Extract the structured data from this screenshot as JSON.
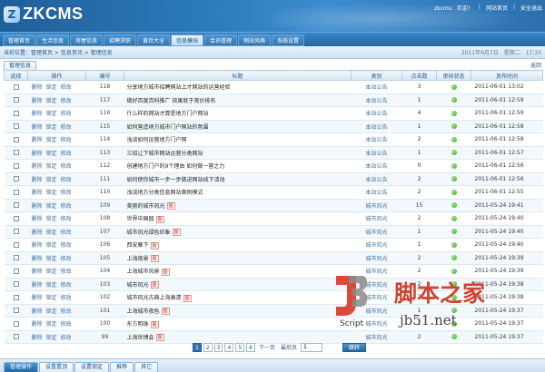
{
  "header": {
    "logo_text": "ZKCMS",
    "logo_mark": "Z",
    "user": "zkcms：欢迎！",
    "link_home": "网站首页",
    "link_logout": "安全退出"
  },
  "nav": [
    "管理首页",
    "生活信息",
    "房屋信息",
    "招聘求职",
    "黄页大全",
    "信息模块",
    "会员管理",
    "网站风格",
    "系统设置"
  ],
  "nav_active_index": 5,
  "crumb": "当前位置：管理首页 > 信息资讯 > 管理信息",
  "date": "2011年6月7日　星期二　17:33",
  "tab": "管理信息",
  "back_label": "返回",
  "columns": [
    "选择",
    "操作",
    "编号",
    "标题",
    "类别",
    "点击数",
    "审核状态",
    "发布时间"
  ],
  "ops": [
    "删除",
    "锁定",
    "修改"
  ],
  "rows": [
    {
      "id": "118",
      "title": "分享地方城市招聘网站上才网站的运营经验",
      "tag": "",
      "cat": "本站公告",
      "clicks": "3",
      "date": "2011-06-01 13:02"
    },
    {
      "id": "117",
      "title": "做好百度百科推广 效果就于竞价排名",
      "tag": "",
      "cat": "本站公告",
      "clicks": "1",
      "date": "2011-06-01 12:59"
    },
    {
      "id": "116",
      "title": "什么样的网站才算是地方门户网站",
      "tag": "",
      "cat": "本站公告",
      "clicks": "4",
      "date": "2011-06-01 12:59"
    },
    {
      "id": "115",
      "title": "如何营造地方城市门户网站的氛围",
      "tag": "",
      "cat": "本站公告",
      "clicks": "1",
      "date": "2011-06-01 12:58"
    },
    {
      "id": "114",
      "title": "浅谈如何运营地方门户网",
      "tag": "",
      "cat": "本站公告",
      "clicks": "2",
      "date": "2011-06-01 12:58"
    },
    {
      "id": "113",
      "title": "三招让下城市网站运营分类网站",
      "tag": "",
      "cat": "本站公告",
      "clicks": "1",
      "date": "2011-06-01 12:57"
    },
    {
      "id": "112",
      "title": "创建地方门户的9个理由 如何做一营之力",
      "tag": "",
      "cat": "本站公告",
      "clicks": "0",
      "date": "2011-06-01 12:56"
    },
    {
      "id": "111",
      "title": "如何使你城市一步一步做进网站线下活动",
      "tag": "",
      "cat": "本站公告",
      "clicks": "2",
      "date": "2011-06-01 12:56"
    },
    {
      "id": "110",
      "title": "浅谈地方分类信息网站案例模式",
      "tag": "",
      "cat": "本站公告",
      "clicks": "2",
      "date": "2011-06-01 12:55"
    },
    {
      "id": "109",
      "title": "美丽的城市风光",
      "tag": "图",
      "cat": "城市风光",
      "clicks": "15",
      "date": "2011-05-24 19:41"
    },
    {
      "id": "108",
      "title": "世界中国园",
      "tag": "图",
      "cat": "城市风光",
      "clicks": "2",
      "date": "2011-05-24 19:40"
    },
    {
      "id": "107",
      "title": "城市风光绿色印象",
      "tag": "图",
      "cat": "城市风光",
      "clicks": "1",
      "date": "2011-05-24 19:40"
    },
    {
      "id": "106",
      "title": "西安雁下",
      "tag": "图",
      "cat": "城市风光",
      "clicks": "1",
      "date": "2011-05-24 19:40"
    },
    {
      "id": "105",
      "title": "上海夜景",
      "tag": "图",
      "cat": "城市风光",
      "clicks": "2",
      "date": "2011-05-24 19:39"
    },
    {
      "id": "104",
      "title": "上海城市风景",
      "tag": "图",
      "cat": "城市风光",
      "clicks": "2",
      "date": "2011-05-24 19:39"
    },
    {
      "id": "103",
      "title": "城市风光",
      "tag": "图",
      "cat": "城市风光",
      "clicks": "2",
      "date": "2011-05-24 19:38"
    },
    {
      "id": "102",
      "title": "城市风光古典上海高清",
      "tag": "图",
      "cat": "城市风光",
      "clicks": "2",
      "date": "2011-05-24 19:38"
    },
    {
      "id": "101",
      "title": "上海城市夜色",
      "tag": "图",
      "cat": "城市风光",
      "clicks": "1",
      "date": "2011-05-24 19:37"
    },
    {
      "id": "100",
      "title": "东方明珠",
      "tag": "图",
      "cat": "城市风光",
      "clicks": "1",
      "date": "2011-05-24 19:37"
    },
    {
      "id": "99",
      "title": "上海世博会",
      "tag": "图",
      "cat": "城市风光",
      "clicks": "2",
      "date": "2011-05-24 19:37"
    }
  ],
  "pager": {
    "pages": [
      "1",
      "2",
      "3",
      "4",
      "5",
      "6"
    ],
    "current": "1",
    "next": "下一页",
    "last": "最后页",
    "jump_value": "1",
    "go": "跳转"
  },
  "bottom_tabs": [
    "管理操作",
    "设置置顶",
    "设置锁定",
    "推荐",
    "其它"
  ],
  "watermark": {
    "cn": "脚本之家",
    "url": "jb51.net",
    "script": "Script"
  },
  "colors": {
    "brand_blue": "#2b78b8",
    "approved_green": "#3ba524",
    "tag_red": "#c0392b"
  }
}
